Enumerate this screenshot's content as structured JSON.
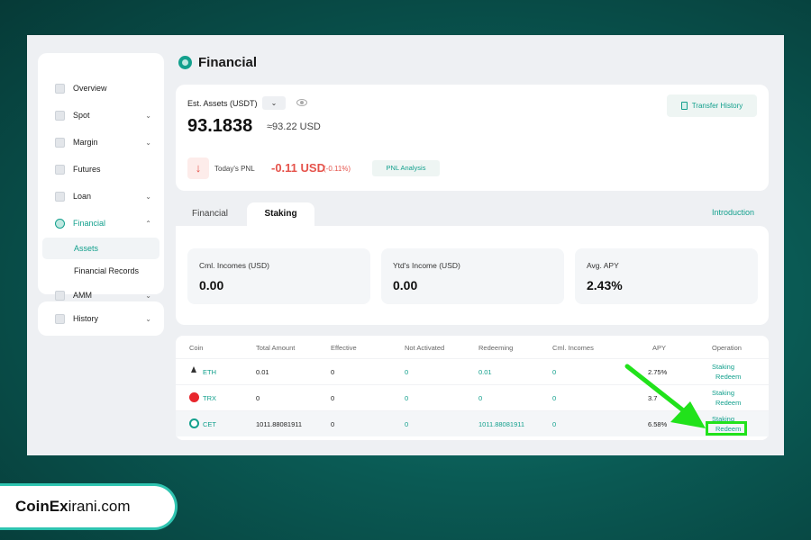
{
  "sidebar": {
    "items": [
      {
        "label": "Overview"
      },
      {
        "label": "Spot"
      },
      {
        "label": "Margin"
      },
      {
        "label": "Futures"
      },
      {
        "label": "Loan"
      },
      {
        "label": "Financial"
      },
      {
        "label": "AMM"
      }
    ],
    "sub_items": [
      {
        "label": "Assets"
      },
      {
        "label": "Financial Records"
      }
    ],
    "history_label": "History"
  },
  "page": {
    "title": "Financial"
  },
  "assets": {
    "est_label": "Est. Assets (USDT)",
    "value": "93.1838",
    "usd": "≈93.22 USD",
    "transfer_label": "Transfer History",
    "pnl_label": "Today's PNL",
    "pnl_value": "-0.11 USD",
    "pnl_pct": "(-0.11%)",
    "pnl_button": "PNL Analysis"
  },
  "tabs": [
    {
      "label": "Financial"
    },
    {
      "label": "Staking"
    }
  ],
  "intro_link": "Introduction",
  "stats": [
    {
      "label": "Cml. Incomes (USD)",
      "value": "0.00"
    },
    {
      "label": "Ytd's Income (USD)",
      "value": "0.00"
    },
    {
      "label": "Avg. APY",
      "value": "2.43%"
    }
  ],
  "table": {
    "headers": [
      "Coin",
      "Total Amount",
      "Effective",
      "Not Activated",
      "Redeeming",
      "Cml. Incomes",
      "APY",
      "Operation"
    ],
    "rows": [
      {
        "coin": "ETH",
        "total": "0.01",
        "effective": "0",
        "not_activated": "0",
        "redeeming": "0.01",
        "cml": "0",
        "apy": "2.75%",
        "op1": "Staking",
        "op2": "Redeem"
      },
      {
        "coin": "TRX",
        "total": "0",
        "effective": "0",
        "not_activated": "0",
        "redeeming": "0",
        "cml": "0",
        "apy": "3.7",
        "op1": "Staking",
        "op2": "Redeem"
      },
      {
        "coin": "CET",
        "total": "1011.88081911",
        "effective": "0",
        "not_activated": "0",
        "redeeming": "1011.88081911",
        "cml": "0",
        "apy": "6.58%",
        "op1": "Staking",
        "op2": "Redeem"
      }
    ]
  },
  "brand": {
    "bold": "CoinEx",
    "rest": "irani.com"
  },
  "colors": {
    "accent": "#13a08d",
    "negative": "#e5534b",
    "highlight": "#21e21b"
  }
}
